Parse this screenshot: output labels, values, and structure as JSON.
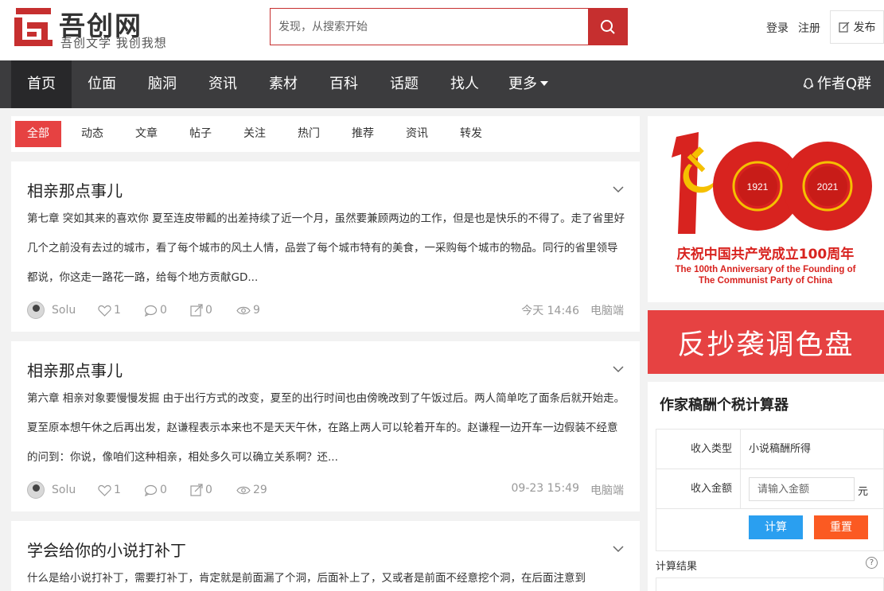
{
  "header": {
    "logo_title": "吾创网",
    "logo_subtitle": "吾创文学 我创我想",
    "search_placeholder": "发现，从搜索开始",
    "login": "登录",
    "register": "注册",
    "publish": "发布"
  },
  "nav": {
    "items": [
      "首页",
      "位面",
      "脑洞",
      "资讯",
      "素材",
      "百科",
      "话题",
      "找人",
      "更多"
    ],
    "qq_group": "作者Q群"
  },
  "tabs": [
    "全部",
    "动态",
    "文章",
    "帖子",
    "关注",
    "热门",
    "推荐",
    "资讯",
    "转发"
  ],
  "posts": [
    {
      "title": "相亲那点事儿",
      "text": "第七章  突如其来的喜欢你  夏至连皮带瓤的出差持续了近一个月，虽然要兼顾两边的工作，但是也是快乐的不得了。走了省里好几个之前没有去过的城市，看了每个城市的风土人情，品尝了每个城市特有的美食，一采购每个城市的物品。同行的省里领导都说，你这走一路花一路，给每个地方贡献GD...",
      "author": "Solu",
      "likes": "1",
      "comments": "0",
      "shares": "0",
      "views": "9",
      "time": "今天 14:46",
      "source": "电脑端"
    },
    {
      "title": "相亲那点事儿",
      "text": "第六章 相亲对象要慢慢发掘 由于出行方式的改变，夏至的出行时间也由傍晚改到了午饭过后。两人简单吃了面条后就开始走。夏至原本想午休之后再出发，赵谦程表示本来也不是天天午休，在路上两人可以轮着开车的。赵谦程一边开车一边假装不经意的问到：你说，像咱们这种相亲，相处多久可以确立关系啊？还...",
      "author": "Solu",
      "likes": "1",
      "comments": "0",
      "shares": "0",
      "views": "29",
      "time": "09-23 15:49",
      "source": "电脑端"
    },
    {
      "title": "学会给你的小说打补丁",
      "text": "什么是给小说打补丁，需要打补丁，肯定就是前面漏了个洞，后面补上了，又或者是前面不经意挖个洞，在后面注意到"
    }
  ],
  "sidebar": {
    "banner": {
      "number": "100",
      "year_left": "1921",
      "year_right": "2021",
      "headline": "庆祝中国共产党成立100周年",
      "en_line1": "The 100th Anniversary of the Founding of",
      "en_line2": "The Communist Party of China"
    },
    "ad_text": "反抄袭调色盘",
    "calculator": {
      "title": "作家稿酬个税计算器",
      "income_type_label": "收入类型",
      "income_type_value": "小说稿酬所得",
      "amount_label": "收入金额",
      "amount_placeholder": "请输入金额",
      "unit": "元",
      "calc_button": "计算",
      "reset_button": "重置",
      "result_label": "计算结果",
      "help": "?"
    }
  },
  "colors": {
    "brand_red": "#c62f2f",
    "accent_red": "#e64242",
    "nav_bg": "#3c3c3e",
    "calc_blue": "#2a9ff0",
    "reset_orange": "#fb5a22"
  }
}
